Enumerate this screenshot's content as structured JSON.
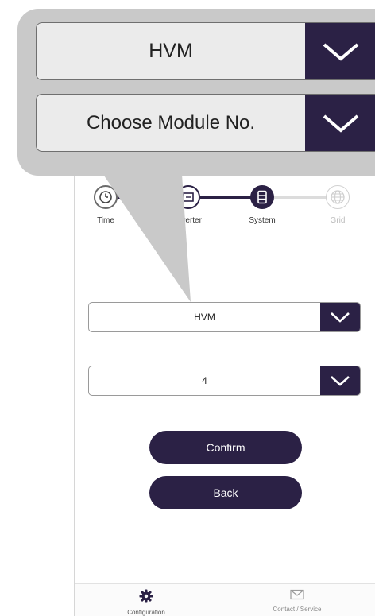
{
  "steps": [
    {
      "label": "Time",
      "state": "done",
      "icon": "clock-icon"
    },
    {
      "label": "Inverter",
      "state": "done",
      "icon": "inverter-icon"
    },
    {
      "label": "System",
      "state": "active",
      "icon": "battery-system-icon"
    },
    {
      "label": "Grid",
      "state": "pending",
      "icon": "globe-icon"
    }
  ],
  "form": {
    "battery_type_value": "HVM",
    "module_count_value": "4",
    "confirm_label": "Confirm",
    "back_label": "Back"
  },
  "bottom_nav": {
    "items": [
      {
        "label": "Configuration",
        "icon": "gear-icon"
      },
      {
        "label": "Contact / Service",
        "icon": "mail-icon"
      }
    ]
  },
  "callout": {
    "battery_type_value": "HVM",
    "module_count_value": "Choose Module No."
  },
  "colors": {
    "primary": "#2b2145",
    "callout_bg": "#c9c9c9",
    "pending": "#d0d0d0"
  }
}
